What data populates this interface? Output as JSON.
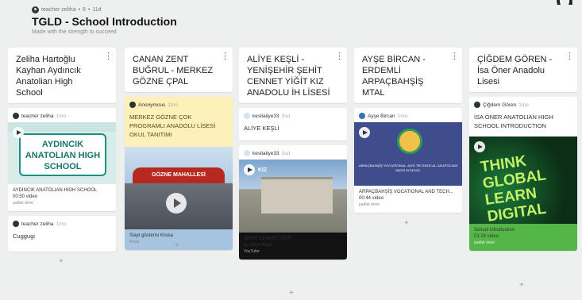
{
  "header": {
    "author": "teacher zeliha",
    "likes": "8",
    "age": "11d",
    "title": "TGLD - School Introduction",
    "subtitle": "Made with the strength to succeed"
  },
  "top_cut_text": "g",
  "more_glyph": "⋮",
  "add_glyph": "+",
  "columns": [
    {
      "title": "Zeliha Hartoğlu Kayhan Aydıncık Anatolian High School",
      "cards": [
        {
          "author": "teacher zeliha",
          "time": "1mo",
          "thumb_text": "AYDINCIK ANATOLIAN HIGH SCHOOL",
          "caption_title": "AYDINCIK ANATOLIAN HIGH SCHOOL",
          "caption_sub1": "00:50 video",
          "caption_sub2": "padlet drive"
        },
        {
          "author": "teacher zeliha",
          "time": "1mo",
          "text": "Cuggugi"
        }
      ]
    },
    {
      "title": "CANAN ZENT BUĞRUL - MERKEZ GÖZNE ÇPAL",
      "cards": [
        {
          "author": "Anonymous",
          "time": "1mo",
          "text": "MERKEZ GÖZNE ÇOK PROGRAMLI ANADOLU LİSESİ OKUL TANITIMI",
          "thumb_text": "GÖZNE MAHALLESİ",
          "caption_title": "Slayt gösterisi Kisisa",
          "caption_sub1": "Kissa"
        }
      ]
    },
    {
      "title": "ALİYE KEŞLİ - YENİŞEHİR ŞEHİT CENNET YİĞİT KIZ ANADOLU İH LİSESİ",
      "cards": [
        {
          "author": "kesliaiiye33",
          "time": "3sd",
          "text": "ALİYE KEŞLİ"
        },
        {
          "author": "kesliaiiye33",
          "time": "3sd",
          "thumb_text": "KIZ",
          "caption_title": "ŞEHİT CENNET YİĞİT",
          "caption_sub1": "by Aliye Keşli",
          "caption_sub2": "YouTube"
        }
      ]
    },
    {
      "title": "AYŞE BİRCAN - ERDEMLİ ARPAÇBAHŞİŞ MTAL",
      "cards": [
        {
          "author": "Ayşe Bircan",
          "time": "1mo",
          "thumb_text": "ARPAÇBAHŞİŞ VOCATIONAL AND TECHNICAL ANATOLIAN HIGH SCHOOL",
          "caption_title": "ARPAÇBAHŞİŞ VOCATIONAL AND TECH...",
          "caption_sub1": "00:44 video",
          "caption_sub2": "padlet drive"
        }
      ]
    },
    {
      "title": "ÇİĞDEM GÖREN - İsa Öner Anadolu Lisesi",
      "cards": [
        {
          "author": "Çiğdem Gören",
          "time": "1mo",
          "text": "İSA ÖNER ANATOLIAN HIGH SCHOOL INTRODUCTION",
          "thumb_text": "THINK GLOBAL LEARN DIGITAL",
          "caption_title": "School introduction",
          "caption_sub1": "01:24 video",
          "caption_sub2": "padlet drive"
        }
      ]
    }
  ],
  "colors": {
    "background": "#eef0ef",
    "card": "#ffffff",
    "anon_card": "#fdf0b8",
    "green_footer": "#55b648",
    "blue_footer": "#a6c3df"
  }
}
